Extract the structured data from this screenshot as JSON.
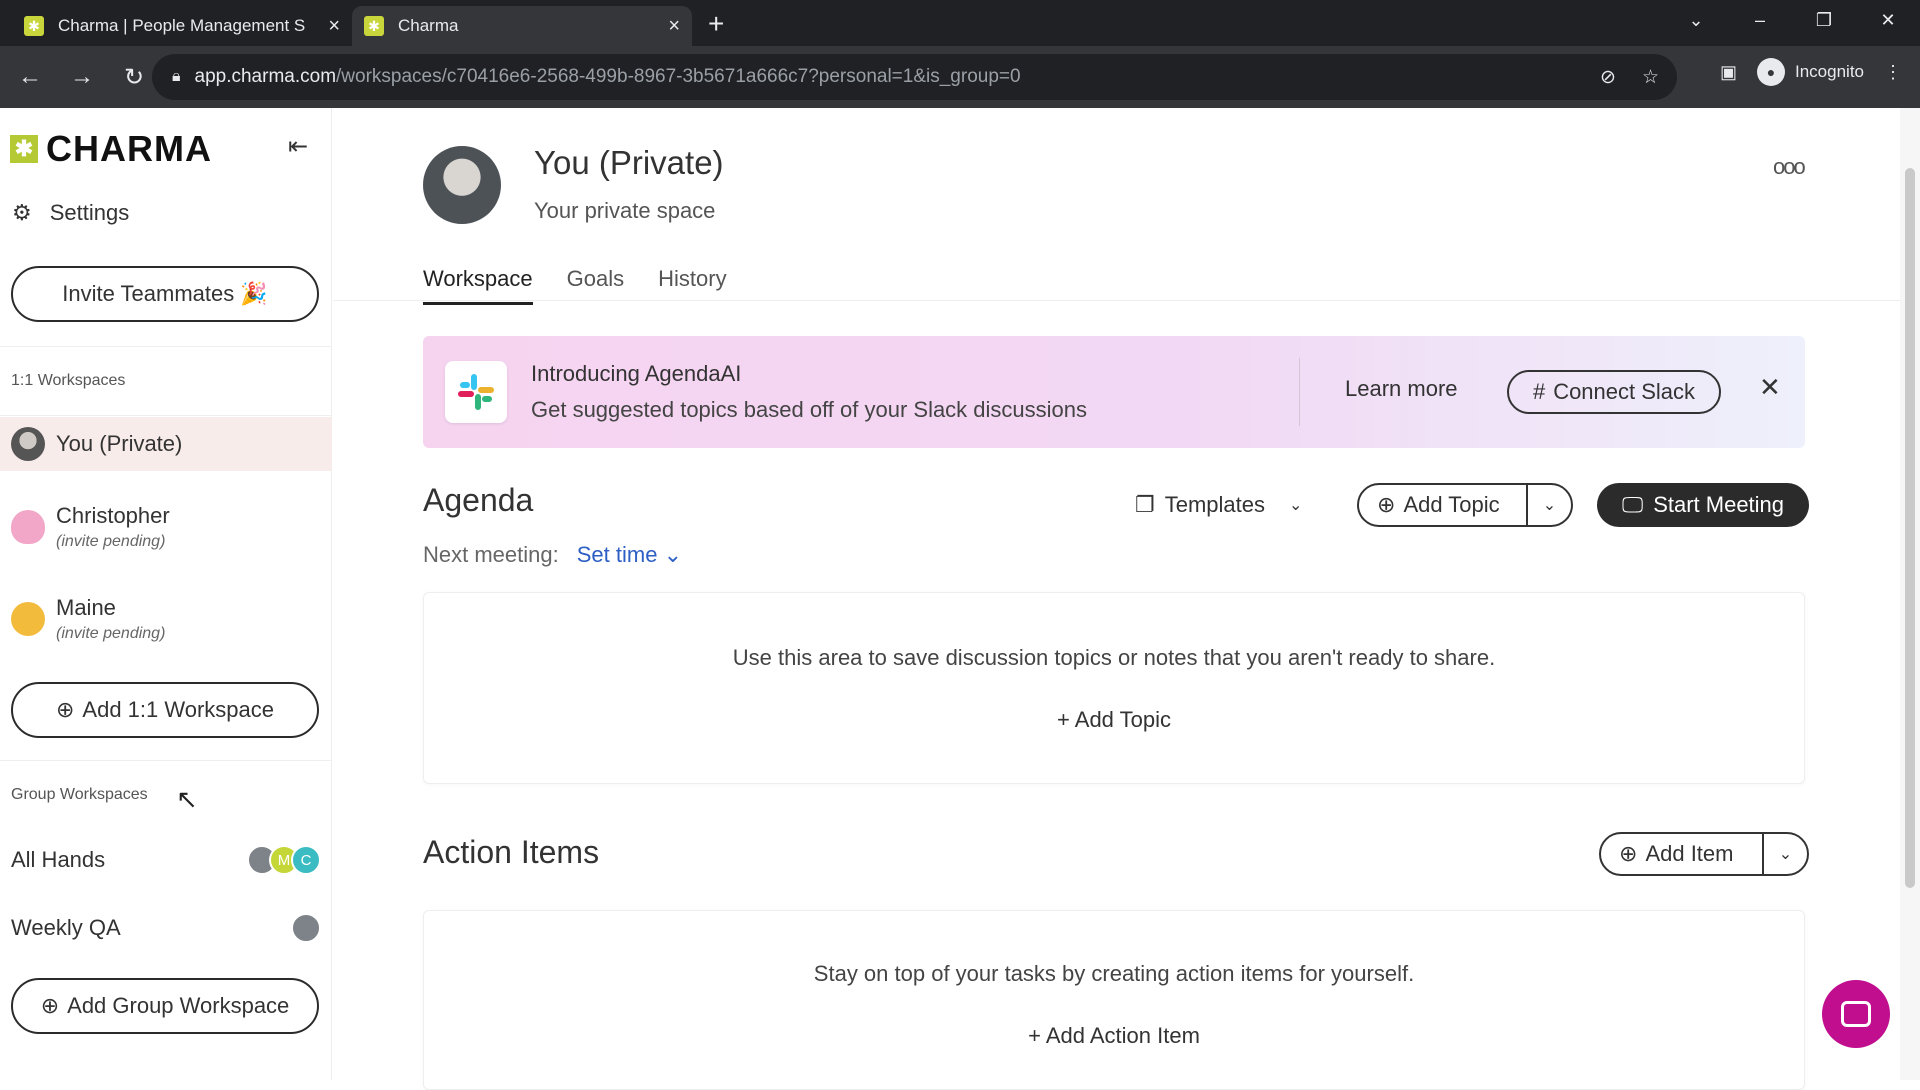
{
  "browser": {
    "tabs": [
      {
        "title": "Charma | People Management S"
      },
      {
        "title": "Charma"
      }
    ],
    "url_host": "app.charma.com",
    "url_path": "/workspaces/c70416e6-2568-499b-8967-3b5671a666c7?personal=1&is_group=0",
    "profile_label": "Incognito"
  },
  "sidebar": {
    "logo_text": "CHARMA",
    "settings_label": "Settings",
    "invite_label": "Invite Teammates 🎉",
    "one_on_one_header": "1:1 Workspaces",
    "workspaces": [
      {
        "name": "You (Private)",
        "sub": ""
      },
      {
        "name": "Christopher",
        "sub": "(invite pending)"
      },
      {
        "name": "Maine",
        "sub": "(invite pending)"
      }
    ],
    "add_workspace_label": "Add 1:1 Workspace",
    "group_header": "Group Workspaces",
    "groups": [
      {
        "name": "All Hands",
        "avatars": [
          "",
          "M",
          "C"
        ]
      },
      {
        "name": "Weekly QA",
        "avatars": [
          ""
        ]
      }
    ],
    "add_group_label": "Add Group Workspace"
  },
  "page": {
    "title": "You (Private)",
    "subtitle": "Your private space",
    "tabs": [
      "Workspace",
      "Goals",
      "History"
    ],
    "active_tab": "Workspace"
  },
  "banner": {
    "heading": "Introducing AgendaAI",
    "desc": "Get suggested topics based off of your Slack discussions",
    "learn_more": "Learn more",
    "connect_label": "Connect Slack"
  },
  "agenda": {
    "heading": "Agenda",
    "templates_label": "Templates",
    "add_topic_label": "Add Topic",
    "start_meeting_label": "Start Meeting",
    "next_meeting_label": "Next meeting:",
    "set_time_label": "Set time",
    "empty_message": "Use this area to save discussion topics or notes that you aren't ready to share.",
    "add_topic_link": "Add Topic"
  },
  "action_items": {
    "heading": "Action Items",
    "add_item_label": "Add Item",
    "empty_message": "Stay on top of your tasks by creating action items for yourself.",
    "add_link": "Add Action Item"
  },
  "colors": {
    "brand": "#b5c935",
    "accent_link": "#2d5fc4",
    "chat": "#c00e8e",
    "selected_row": "#f8ecea"
  }
}
